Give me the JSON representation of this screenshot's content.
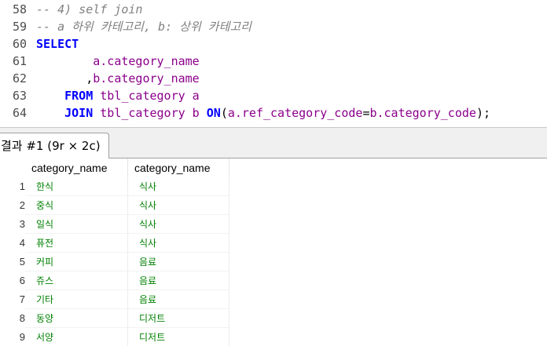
{
  "editor": {
    "lines": [
      {
        "num": "58",
        "parts": [
          {
            "t": "-- 4) self join",
            "c": "cm"
          }
        ]
      },
      {
        "num": "59",
        "parts": [
          {
            "t": "-- a 하위 카테고리, b: 상위 카테고리",
            "c": "cm"
          }
        ]
      },
      {
        "num": "60",
        "parts": [
          {
            "t": "SELECT",
            "c": "kw"
          }
        ]
      },
      {
        "num": "61",
        "parts": [
          {
            "t": "        ",
            "c": "tx"
          },
          {
            "t": "a.category_name",
            "c": "id"
          }
        ]
      },
      {
        "num": "62",
        "parts": [
          {
            "t": "       ,",
            "c": "tx"
          },
          {
            "t": "b.category_name",
            "c": "id"
          }
        ]
      },
      {
        "num": "63",
        "parts": [
          {
            "t": "    ",
            "c": "tx"
          },
          {
            "t": "FROM",
            "c": "kw"
          },
          {
            "t": " ",
            "c": "tx"
          },
          {
            "t": "tbl_category a",
            "c": "id"
          }
        ]
      },
      {
        "num": "64",
        "parts": [
          {
            "t": "    ",
            "c": "tx"
          },
          {
            "t": "JOIN",
            "c": "kw"
          },
          {
            "t": " ",
            "c": "tx"
          },
          {
            "t": "tbl_category b",
            "c": "id"
          },
          {
            "t": " ",
            "c": "tx"
          },
          {
            "t": "ON",
            "c": "kw"
          },
          {
            "t": "(",
            "c": "tx"
          },
          {
            "t": "a.ref_category_code",
            "c": "id"
          },
          {
            "t": "=",
            "c": "tx"
          },
          {
            "t": "b.category_code",
            "c": "id"
          },
          {
            "t": ");",
            "c": "tx"
          }
        ]
      }
    ]
  },
  "results": {
    "tab_label": "결과 #1 (9r × 2c)",
    "columns": [
      "category_name",
      "category_name"
    ],
    "rows": [
      [
        "한식",
        "식사"
      ],
      [
        "중식",
        "식사"
      ],
      [
        "일식",
        "식사"
      ],
      [
        "퓨전",
        "식사"
      ],
      [
        "커피",
        "음료"
      ],
      [
        "쥬스",
        "음료"
      ],
      [
        "기타",
        "음료"
      ],
      [
        "동양",
        "디저트"
      ],
      [
        "서양",
        "디저트"
      ]
    ],
    "row_numbers": [
      "1",
      "2",
      "3",
      "4",
      "5",
      "6",
      "7",
      "8",
      "9"
    ]
  }
}
